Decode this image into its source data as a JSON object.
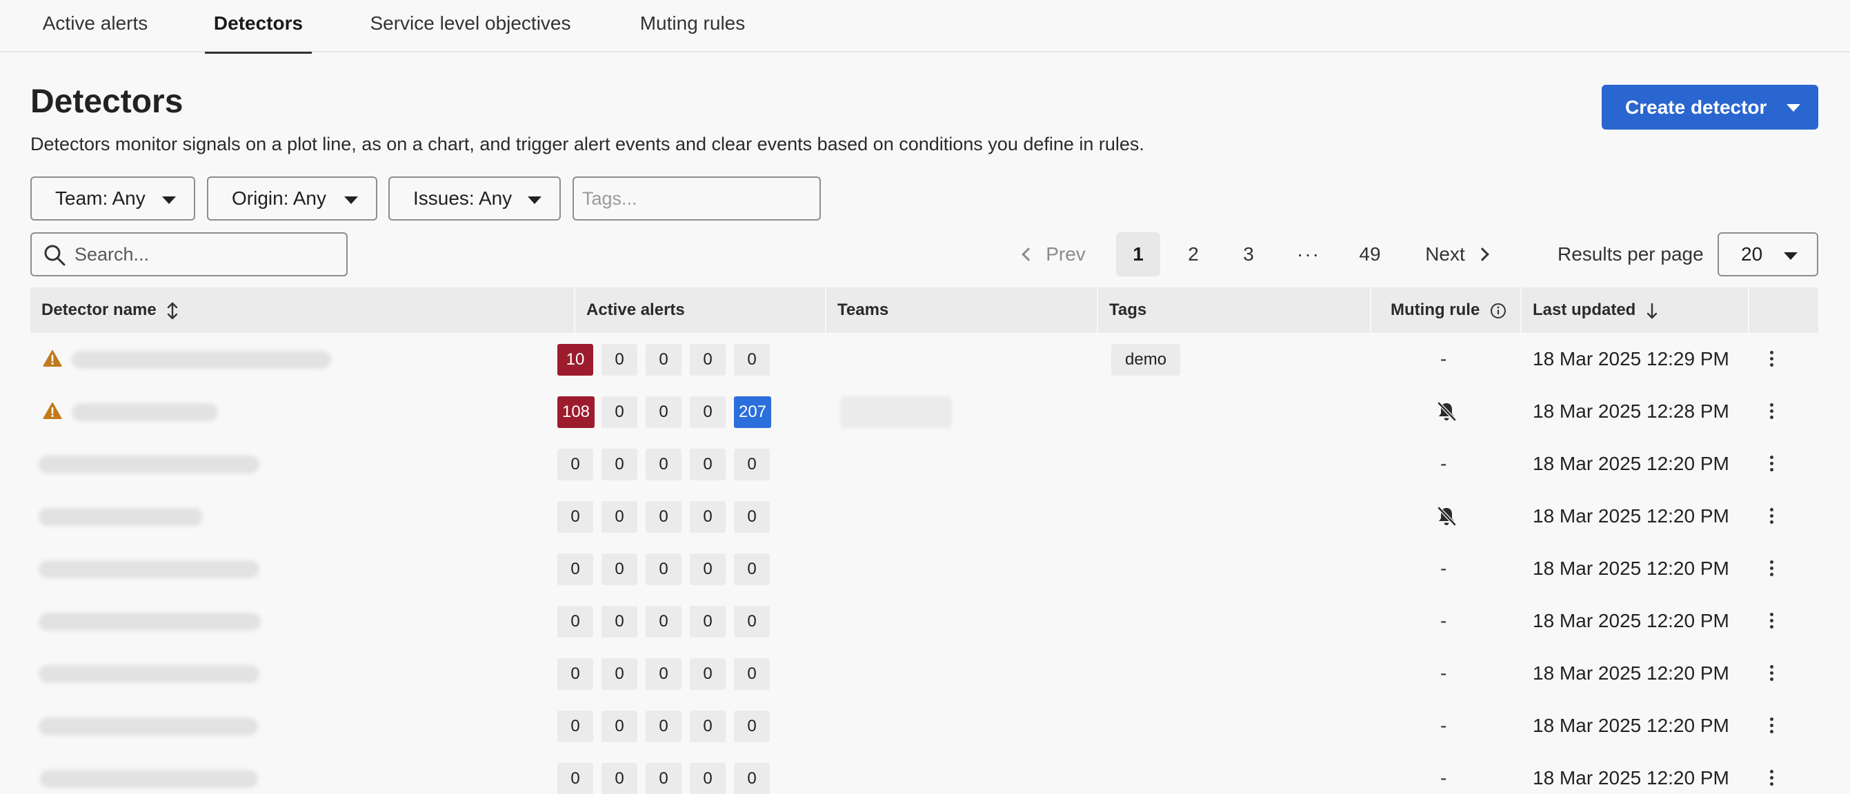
{
  "tabs": [
    {
      "label": "Active alerts",
      "active": false
    },
    {
      "label": "Detectors",
      "active": true
    },
    {
      "label": "Service level objectives",
      "active": false
    },
    {
      "label": "Muting rules",
      "active": false
    }
  ],
  "header": {
    "title": "Detectors",
    "description": "Detectors monitor signals on a plot line, as on a chart, and trigger alert events and clear events based on conditions you define in rules.",
    "create_label": "Create detector"
  },
  "filters": {
    "team": "Team: Any",
    "origin": "Origin: Any",
    "issues": "Issues: Any",
    "tags_placeholder": "Tags...",
    "search_placeholder": "Search..."
  },
  "pagination": {
    "prev": "Prev",
    "pages": [
      "1",
      "2",
      "3",
      "···",
      "49"
    ],
    "current": "1",
    "next": "Next",
    "results_label": "Results per page",
    "results_value": "20"
  },
  "table": {
    "columns": {
      "name": "Detector name",
      "alerts": "Active alerts",
      "teams": "Teams",
      "tags": "Tags",
      "muting": "Muting rule",
      "updated": "Last updated"
    },
    "rows": [
      {
        "warning": true,
        "alerts": [
          "10",
          "0",
          "0",
          "0",
          "0"
        ],
        "crit_first": true,
        "info_last": false,
        "tag": "demo",
        "team": false,
        "muted": false,
        "muting_text": "-",
        "updated": "18 Mar 2025 12:29 PM"
      },
      {
        "warning": true,
        "alerts": [
          "108",
          "0",
          "0",
          "0",
          "207"
        ],
        "crit_first": true,
        "info_last": true,
        "tag": "",
        "team": true,
        "muted": true,
        "muting_text": "",
        "updated": "18 Mar 2025 12:28 PM"
      },
      {
        "warning": false,
        "alerts": [
          "0",
          "0",
          "0",
          "0",
          "0"
        ],
        "crit_first": false,
        "info_last": false,
        "tag": "",
        "team": false,
        "muted": false,
        "muting_text": "-",
        "updated": "18 Mar 2025 12:20 PM"
      },
      {
        "warning": false,
        "alerts": [
          "0",
          "0",
          "0",
          "0",
          "0"
        ],
        "crit_first": false,
        "info_last": false,
        "tag": "",
        "team": false,
        "muted": true,
        "muting_text": "",
        "updated": "18 Mar 2025 12:20 PM"
      },
      {
        "warning": false,
        "alerts": [
          "0",
          "0",
          "0",
          "0",
          "0"
        ],
        "crit_first": false,
        "info_last": false,
        "tag": "",
        "team": false,
        "muted": false,
        "muting_text": "-",
        "updated": "18 Mar 2025 12:20 PM"
      },
      {
        "warning": false,
        "alerts": [
          "0",
          "0",
          "0",
          "0",
          "0"
        ],
        "crit_first": false,
        "info_last": false,
        "tag": "",
        "team": false,
        "muted": false,
        "muting_text": "-",
        "updated": "18 Mar 2025 12:20 PM"
      },
      {
        "warning": false,
        "alerts": [
          "0",
          "0",
          "0",
          "0",
          "0"
        ],
        "crit_first": false,
        "info_last": false,
        "tag": "",
        "team": false,
        "muted": false,
        "muting_text": "-",
        "updated": "18 Mar 2025 12:20 PM"
      },
      {
        "warning": false,
        "alerts": [
          "0",
          "0",
          "0",
          "0",
          "0"
        ],
        "crit_first": false,
        "info_last": false,
        "tag": "",
        "team": false,
        "muted": false,
        "muting_text": "-",
        "updated": "18 Mar 2025 12:20 PM"
      },
      {
        "warning": false,
        "alerts": [
          "0",
          "0",
          "0",
          "0",
          "0"
        ],
        "crit_first": false,
        "info_last": false,
        "tag": "",
        "team": false,
        "muted": false,
        "muting_text": "-",
        "updated": "18 Mar 2025 12:20 PM"
      }
    ]
  },
  "colors": {
    "accent": "#2a66d0",
    "critical": "#9c1c2e",
    "info": "#2a6fdb",
    "warning": "#c17a1c"
  }
}
